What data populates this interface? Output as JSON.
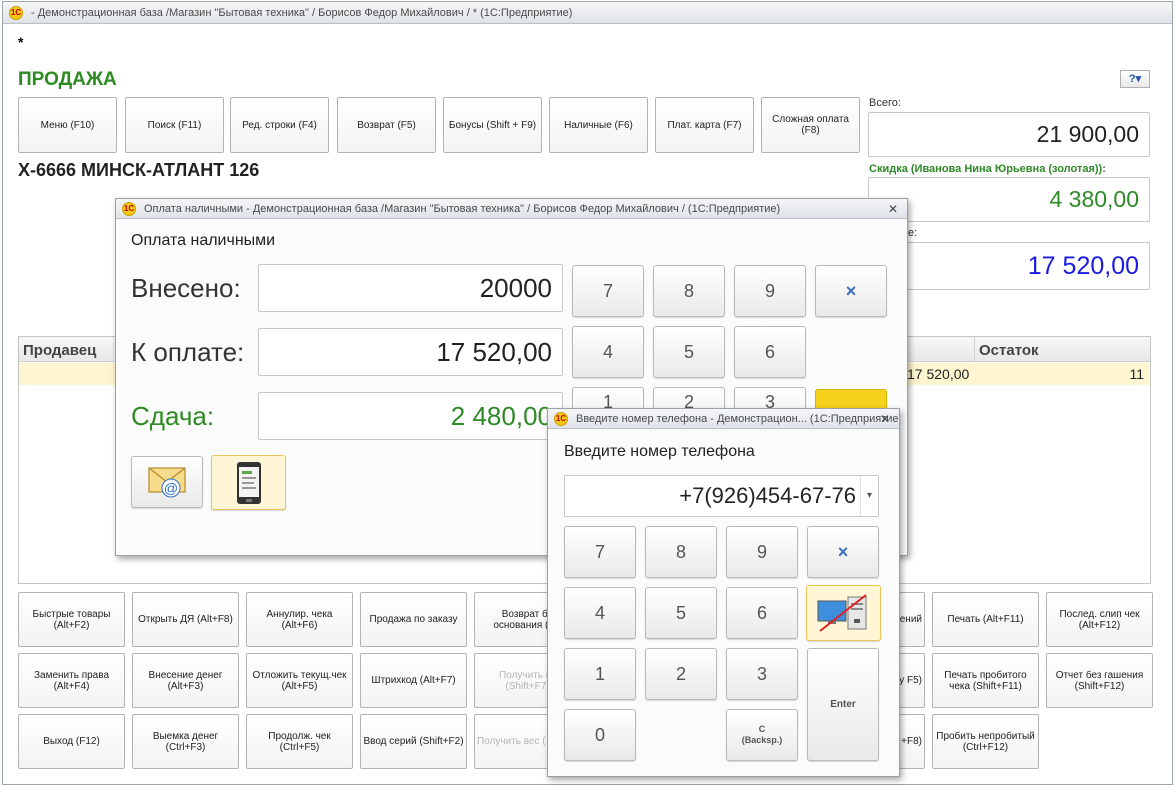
{
  "main_window": {
    "title": " - Демонстрационная база /Магазин \"Бытовая техника\" / Борисов Федор Михайлович / * (1С:Предприятие)",
    "modified_marker": "*",
    "heading": "ПРОДАЖА",
    "help_icon": "help-icon",
    "toolbar": [
      "Меню (F10)",
      "Поиск (F11)",
      "Ред. строки (F4)",
      "Возврат (F5)",
      "Бонусы (Shift + F9)",
      "Наличные (F6)",
      "Плат. карта (F7)",
      "Сложная оплата (F8)"
    ],
    "item_name": "Х-6666 МИНСК-АТЛАНТ 126",
    "totals": {
      "total_label": "Всего:",
      "total_value": "21 900,00",
      "discount_label": "Скидка (Иванова Нина Юрьевна (золотая)):",
      "discount_value": "4 380,00",
      "topay_label": "е:",
      "topay_value": "17 520,00"
    },
    "table": {
      "col_seller": "Продавец",
      "col_rest": "Остаток",
      "row_amount": "17 520,00",
      "row_rest": "11"
    },
    "bottom_buttons": {
      "row1": [
        "Быстрые товары (Alt+F2)",
        "Открыть ДЯ (Alt+F8)",
        "Аннулир. чека (Alt+F6)",
        "Продажа по заказу",
        "Возврат бе основания (Ctr",
        "ений",
        "Печать (Alt+F11)",
        "Послед. слип чек (Alt+F12)"
      ],
      "row2": [
        "Заменить права (Alt+F4)",
        "Внесение денег (Alt+F3)",
        "Отложить текущ.чек (Alt+F5)",
        "Штрихкод (Alt+F7)",
        "Получить из (Shift+F7)",
        "ту F5)",
        "Печать пробитого чека (Shift+F11)",
        "Отчет без гашения (Shift+F12)"
      ],
      "row3": [
        "Выход (F12)",
        "Выемка денег (Ctrl+F3)",
        "Продолж. чек (Ctrl+F5)",
        "Ввод серий (Shift+F2)",
        "Получить вес (",
        "+F8)",
        "Пробить непробитый (Ctrl+F12)"
      ]
    }
  },
  "cash_dialog": {
    "title": "Оплата наличными - Демонстрационная база /Магазин \"Бытовая техника\" / Борисов Федор Михайлович /  (1С:Предприятие)",
    "heading": "Оплата наличными",
    "paid_label": "Внесено:",
    "paid_value": "20000",
    "due_label": "К оплате:",
    "due_value": "17 520,00",
    "change_label": "Сдача:",
    "change_value": "2 480,00",
    "keys": [
      "7",
      "8",
      "9",
      "×",
      "4",
      "5",
      "6",
      "1",
      "2",
      "3"
    ],
    "email_icon": "email-icon",
    "phone_icon": "phone-icon"
  },
  "phone_dialog": {
    "title": "Введите номер телефона - Демонстрацион... (1С:Предприятие)",
    "heading": "Введите номер телефона",
    "phone_value": "+7(926)454-67-76",
    "keys": [
      "7",
      "8",
      "9",
      "×",
      "4",
      "5",
      "6",
      "1",
      "2",
      "3",
      "0"
    ],
    "backspace_label": "C\n(Backsp.)",
    "enter_label": "Enter",
    "screen_toggle_icon": "screen-off-icon"
  },
  "colors": {
    "heading_green": "#2e8b22",
    "discount_green": "#2d8a26",
    "topay_blue": "#1a1ae0",
    "row_highlight": "#fdf5d0",
    "accent_yellow": "#f6d21c"
  }
}
